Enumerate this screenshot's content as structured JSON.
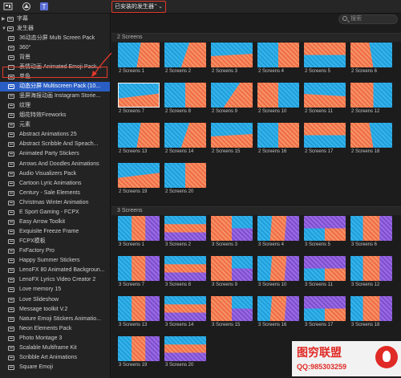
{
  "topbar": {
    "icons": [
      "library-icon",
      "photos-icon",
      "titles-icon"
    ],
    "dropdown_label": "已安装的发生器",
    "dropdown_arrow": "⌃⌄"
  },
  "search": {
    "placeholder": "搜索"
  },
  "sidebar": {
    "items": [
      {
        "label": "字幕",
        "type": "category",
        "expanded": false
      },
      {
        "label": "发生器",
        "type": "category",
        "expanded": true
      },
      {
        "label": "36动态分屏 Multi Screen Pack",
        "type": "item"
      },
      {
        "label": "360°",
        "type": "item"
      },
      {
        "label": "背景",
        "type": "item"
      },
      {
        "label": "表情动画 Animated Emoji Pack...",
        "type": "item"
      },
      {
        "label": "单色",
        "type": "item"
      },
      {
        "label": "动态分屏 Multiscreen Pack (10...",
        "type": "item",
        "selected": true
      },
      {
        "label": "竖屏海报动画 Instagram Storie...",
        "type": "item"
      },
      {
        "label": "纹理",
        "type": "item"
      },
      {
        "label": "烟花特效Fireworks",
        "type": "item"
      },
      {
        "label": "元素",
        "type": "item"
      },
      {
        "label": "Abstract Animations 25",
        "type": "item"
      },
      {
        "label": "Abstract Scribble And Speach...",
        "type": "item"
      },
      {
        "label": "Animated Party Stickers",
        "type": "item"
      },
      {
        "label": "Arrows And Doodles Animations",
        "type": "item"
      },
      {
        "label": "Audio Visualizers Pack",
        "type": "item"
      },
      {
        "label": "Cartoon Lyric Animations",
        "type": "item"
      },
      {
        "label": "Century - Sale Elements",
        "type": "item"
      },
      {
        "label": "Christmas Winter Animation",
        "type": "item"
      },
      {
        "label": "E Sport Gaming - FCPX",
        "type": "item"
      },
      {
        "label": "Easy Arrow Toolkit",
        "type": "item"
      },
      {
        "label": "Exquisite Freeze Frame",
        "type": "item"
      },
      {
        "label": "FCPX模板",
        "type": "item"
      },
      {
        "label": "FxFactory Pro",
        "type": "item"
      },
      {
        "label": "Happy Summer Stickers",
        "type": "item"
      },
      {
        "label": "LenoFX 80 Animated Backgroun...",
        "type": "item"
      },
      {
        "label": "LenoFX Lyrics Video Creator 2",
        "type": "item"
      },
      {
        "label": "Love memory 15",
        "type": "item"
      },
      {
        "label": "Love Slideshow",
        "type": "item"
      },
      {
        "label": "Message toolkit V.2",
        "type": "item"
      },
      {
        "label": "Nature Emoji Stickers Animatio...",
        "type": "item"
      },
      {
        "label": "Neon Elements Pack",
        "type": "item"
      },
      {
        "label": "Photo Montage 3",
        "type": "item"
      },
      {
        "label": "Scalable Multiframe Kit",
        "type": "item"
      },
      {
        "label": "Scribble Art Animations",
        "type": "item"
      },
      {
        "label": "Square Emoji",
        "type": "item"
      }
    ]
  },
  "sections": [
    {
      "title": "2 Screens",
      "items": [
        "2 Screens 1",
        "2 Screens 2",
        "2 Screens 3",
        "2 Screens 4",
        "2 Screens 5",
        "2 Screens 6",
        "2 Screens 7",
        "2 Screens 8",
        "2 Screens 9",
        "2 Screens 10",
        "2 Screens 11",
        "2 Screens 12",
        "2 Screens 13",
        "2 Screens 14",
        "2 Screens 15",
        "2 Screens 16",
        "2 Screens 17",
        "2 Screens 18",
        "2 Screens 19",
        "2 Screens 20"
      ]
    },
    {
      "title": "3 Screens",
      "items": [
        "3 Screens 1",
        "3 Screens 2",
        "3 Screens 3",
        "3 Screens 4",
        "3 Screens 5",
        "3 Screens 6",
        "3 Screens 7",
        "3 Screens 8",
        "3 Screens 9",
        "3 Screens 10",
        "3 Screens 11",
        "3 Screens 12",
        "3 Screens 13",
        "3 Screens 14",
        "3 Screens 15",
        "3 Screens 16",
        "3 Screens 17",
        "3 Screens 18",
        "3 Screens 19",
        "3 Screens 20"
      ]
    }
  ],
  "watermark": {
    "title": "图穷联盟",
    "qq": "QQ:985303259"
  },
  "colors": {
    "accent_red": "#e03a2a",
    "selection_blue": "#2a5ec4",
    "thumb_blue": "#1e9fdc",
    "thumb_red": "#ef6b4e",
    "thumb_purple": "#7d4fd0"
  }
}
